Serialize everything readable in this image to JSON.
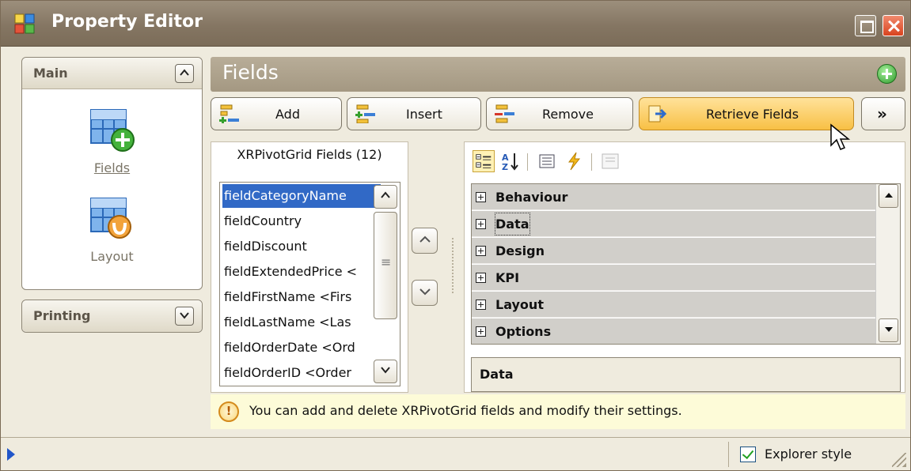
{
  "window": {
    "title": "Property Editor"
  },
  "nav": {
    "main_group": {
      "title": "Main",
      "items": [
        {
          "label": "Fields",
          "icon": "fields-grid-add-icon"
        },
        {
          "label": "Layout",
          "icon": "layout-grid-icon"
        }
      ]
    },
    "printing_group": {
      "title": "Printing"
    }
  },
  "panel": {
    "title": "Fields"
  },
  "toolbar": {
    "add": "Add",
    "insert": "Insert",
    "remove": "Remove",
    "retrieve": "Retrieve Fields",
    "more": "»"
  },
  "field_list": {
    "caption": "XRPivotGrid Fields (12)",
    "items": [
      "fieldCategoryName",
      "fieldCountry",
      "fieldDiscount",
      "fieldExtendedPrice <",
      "fieldFirstName <Firs",
      "fieldLastName <Las",
      "fieldOrderDate <Ord",
      "fieldOrderID <Order"
    ],
    "selected_index": 0
  },
  "property_grid": {
    "categories": [
      "Behaviour",
      "Data",
      "Design",
      "KPI",
      "Layout",
      "Options"
    ],
    "focused_category": "Data",
    "description": "Data"
  },
  "hint": {
    "text": "You can add and delete XRPivotGrid fields and modify their settings."
  },
  "status": {
    "explorer_style_label": "Explorer style",
    "explorer_style_checked": true
  },
  "colors": {
    "accent": "#3169c6",
    "hot_button": "#f8c045",
    "header": "#a49882"
  }
}
